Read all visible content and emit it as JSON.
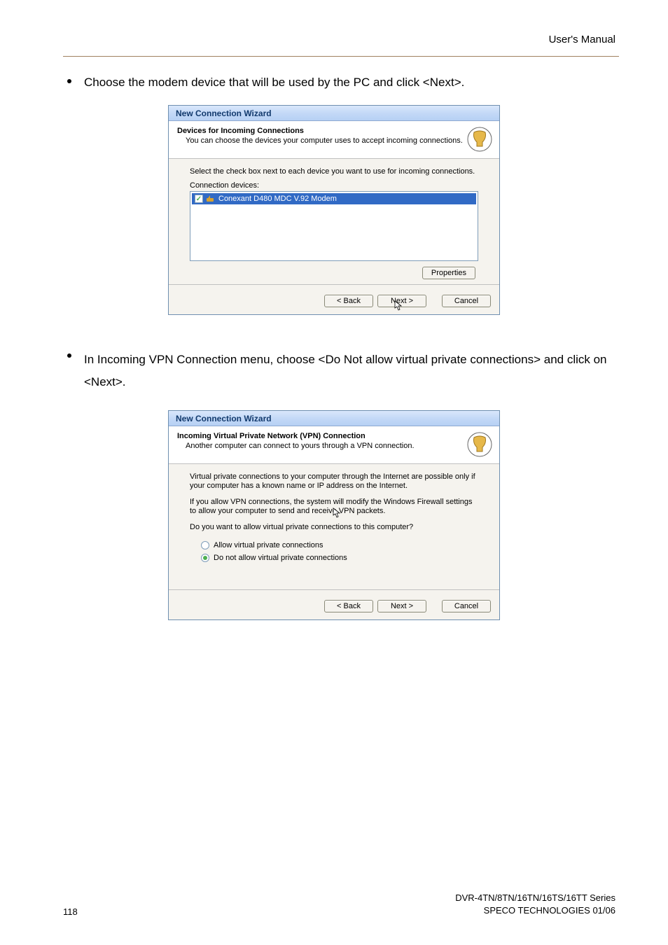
{
  "header": {
    "manual": "User's Manual"
  },
  "body": {
    "line1": "Choose the modem device that will be used by the PC and click <Next>.",
    "line2": "In Incoming VPN Connection menu, choose <Do Not allow virtual private connections> and click on <Next>."
  },
  "wizard1": {
    "title": "New Connection Wizard",
    "header_title": "Devices for Incoming Connections",
    "header_sub": "You can choose the devices your computer uses to accept incoming connections.",
    "instruction": "Select the check box next to each device you want to use for incoming connections.",
    "devices_label": "Connection devices:",
    "device": "Conexant D480 MDC V.92 Modem",
    "properties": "Properties",
    "back": "< Back",
    "next": "Next >",
    "cancel": "Cancel"
  },
  "wizard2": {
    "title": "New Connection Wizard",
    "header_title": "Incoming Virtual Private Network (VPN) Connection",
    "header_sub": "Another computer can connect to yours through a VPN connection.",
    "para1": "Virtual private connections to your computer through the Internet are possible only if your computer has a known name or IP address on the Internet.",
    "para2": "If you allow VPN connections, the system will modify the Windows Firewall settings to allow your computer to send and receive VPN packets.",
    "question": "Do you want to allow virtual private connections to this computer?",
    "opt_allow": "Allow virtual private connections",
    "opt_deny": "Do not allow virtual private connections",
    "back": "< Back",
    "next": "Next >",
    "cancel": "Cancel"
  },
  "footer": {
    "page": "118",
    "product": "DVR-4TN/8TN/16TN/16TS/16TT Series",
    "company": "SPECO TECHNOLOGIES 01/06"
  }
}
